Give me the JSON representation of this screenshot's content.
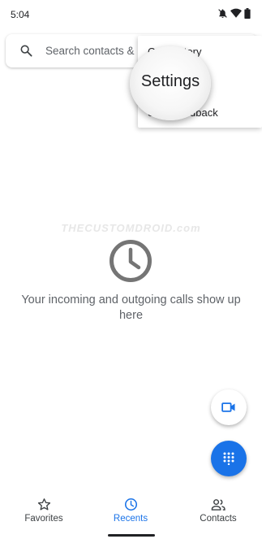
{
  "status_bar": {
    "time": "5:04",
    "icons": [
      "bell-off-icon",
      "wifi-icon",
      "battery-icon"
    ]
  },
  "search": {
    "placeholder": "Search contacts & places",
    "icon": "search-icon"
  },
  "overflow_menu": {
    "items": [
      {
        "label": "Call History"
      },
      {
        "label": "Settings"
      },
      {
        "label": "Send feedback"
      }
    ]
  },
  "magnifier": {
    "label": "Settings"
  },
  "watermark": "THECUSTOMDROID.com",
  "empty_state": {
    "icon": "clock-icon",
    "message": "Your incoming and outgoing calls show up here"
  },
  "fabs": {
    "video_icon": "videocam-icon",
    "dialpad_icon": "dialpad-icon"
  },
  "bottom_nav": {
    "items": [
      {
        "label": "Favorites",
        "icon": "star-icon",
        "active": false
      },
      {
        "label": "Recents",
        "icon": "clock-icon",
        "active": true
      },
      {
        "label": "Contacts",
        "icon": "people-icon",
        "active": false
      }
    ]
  },
  "colors": {
    "accent": "#1a73e8",
    "text_secondary": "#5f6368",
    "empty_icon": "#757575"
  }
}
